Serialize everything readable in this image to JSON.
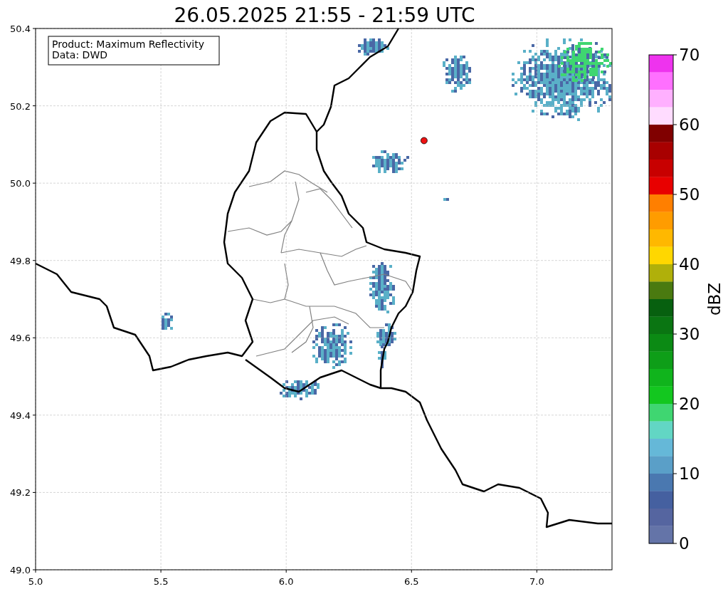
{
  "title": "26.05.2025 21:55 - 21:59 UTC",
  "info_box": [
    "Product: Maximum Reflectivity",
    "Data: DWD"
  ],
  "map": {
    "chart_data": {
      "type": "scatter",
      "grid": true,
      "x": [
        6.55
      ],
      "series": [
        {
          "color": "#ee1111",
          "values": [
            50.11
          ]
        }
      ],
      "xlim": [
        5,
        7.3
      ],
      "ylim": [
        49,
        50.4
      ],
      "xticks": [
        {
          "value": 5,
          "label": "5.0"
        },
        {
          "value": 5.5,
          "label": "5.5"
        },
        {
          "value": 6,
          "label": "6.0"
        },
        {
          "value": 6.5,
          "label": "6.5"
        },
        {
          "value": 7,
          "label": "7.0"
        }
      ],
      "yticks": [
        {
          "value": 49,
          "label": "49.0"
        },
        {
          "value": 49.2,
          "label": "49.2"
        },
        {
          "value": 49.4,
          "label": "49.4"
        },
        {
          "value": 49.6,
          "label": "49.6"
        },
        {
          "value": 49.8,
          "label": "49.8"
        },
        {
          "value": 50,
          "label": "50.0"
        },
        {
          "value": 50.2,
          "label": "50.2"
        },
        {
          "value": 50.4,
          "label": "50.4"
        }
      ]
    }
  },
  "colorbar": {
    "label": "dBZ",
    "ticks": [
      "70",
      "60",
      "50",
      "40",
      "30",
      "20",
      "10",
      "0"
    ],
    "segments": [
      {
        "color": "#ee33ee"
      },
      {
        "color": "#ff70ff"
      },
      {
        "color": "#ffb0ff"
      },
      {
        "color": "#ffdcff"
      },
      {
        "color": "#800000"
      },
      {
        "color": "#a80000"
      },
      {
        "color": "#c80000"
      },
      {
        "color": "#e80000"
      },
      {
        "color": "#ff7f00"
      },
      {
        "color": "#ff9c00"
      },
      {
        "color": "#ffb800"
      },
      {
        "color": "#ffd700"
      },
      {
        "color": "#b0b00a"
      },
      {
        "color": "#4a7a10"
      },
      {
        "color": "#07600f"
      },
      {
        "color": "#0a7512"
      },
      {
        "color": "#0b8a14"
      },
      {
        "color": "#0e9e18"
      },
      {
        "color": "#10b41c"
      },
      {
        "color": "#13c71f"
      },
      {
        "color": "#3fd671"
      },
      {
        "color": "#62d6c4"
      },
      {
        "color": "#65b8d8"
      },
      {
        "color": "#5a9fc8"
      },
      {
        "color": "#4a78b0"
      },
      {
        "color": "#4560a0"
      },
      {
        "color": "#5565a0"
      },
      {
        "color": "#6474a8"
      }
    ]
  }
}
